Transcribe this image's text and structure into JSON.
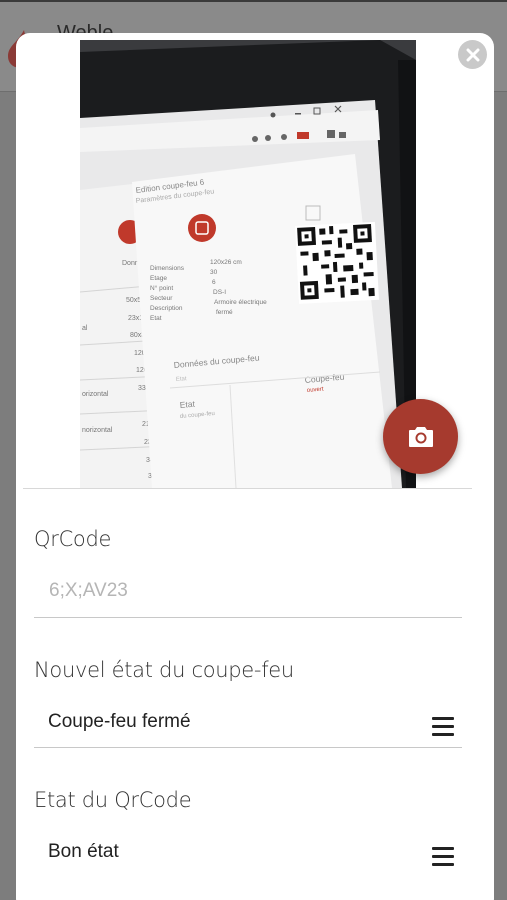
{
  "appbar": {
    "title": "Weble",
    "brand_color": "#c0282d"
  },
  "modal": {
    "close_icon": "close-icon",
    "camera_icon": "camera-icon",
    "accent_color": "#a63a2e",
    "photo": {
      "description_texts": {
        "dialog_title": "Edition coupe-feu 6",
        "dialog_subtitle": "Paramètres du coupe-feu",
        "row_labels": [
          "Dimensions",
          "Etage",
          "N° point",
          "Secteur",
          "Description",
          "Etat"
        ],
        "row_values": [
          "120x26 cm",
          "30",
          "6",
          "DS-I",
          "Armoire électrique",
          "fermé"
        ],
        "section_title": "Données du coupe-feu",
        "section_left": "Etat",
        "section_left_sub": "du coupe-feu",
        "section_right": "Coupe-feu",
        "section_right_sub": "ouvert"
      }
    },
    "fields": {
      "qrcode": {
        "label": "QrCode",
        "placeholder": "6;X;AV23"
      },
      "nouvel_etat": {
        "label": "Nouvel état du coupe-feu",
        "value": "Coupe-feu fermé",
        "icon": "menu-icon"
      },
      "etat_qrcode": {
        "label": "Etat du QrCode",
        "value": "Bon état",
        "icon": "menu-icon"
      }
    }
  }
}
